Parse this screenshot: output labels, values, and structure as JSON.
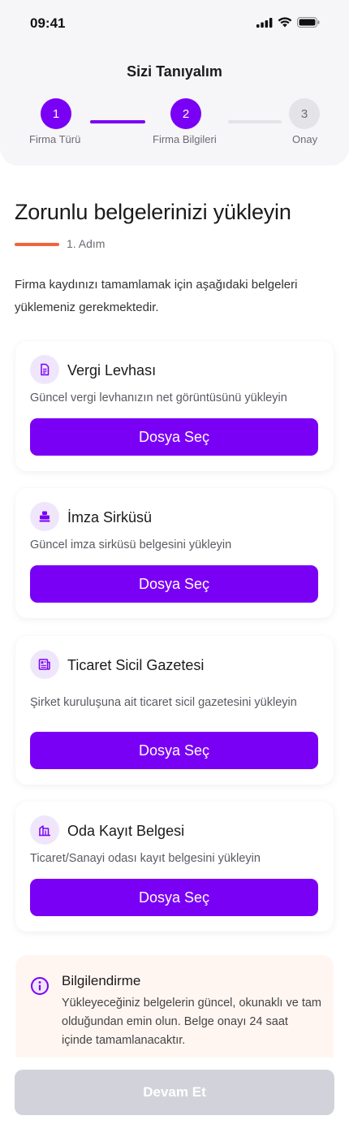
{
  "status_bar": {
    "time": "09:41"
  },
  "header": {
    "title": "Sizi Tanıyalım"
  },
  "stepper": {
    "steps": [
      {
        "number": "1",
        "label": "Firma Türü"
      },
      {
        "number": "2",
        "label": "Firma Bilgileri"
      },
      {
        "number": "3",
        "label": "Onay"
      }
    ],
    "current_step": 2,
    "active_color": "#7a00f5",
    "inactive_color": "#e3e3e8"
  },
  "main": {
    "heading": "Zorunlu belgelerinizi yükleyin",
    "step_indicator": "1. Adım",
    "description": "Firma kaydınızı tamamlamak için aşağıdaki belgeleri yüklemeniz gerekmektedir."
  },
  "documents": [
    {
      "icon": "document-icon",
      "title": "Vergi Levhası",
      "description": "Güncel vergi levhanızın net görüntüsünü yükleyin",
      "button_label": "Dosya Seç"
    },
    {
      "icon": "stamp-icon",
      "title": "İmza Sirküsü",
      "description": "Güncel imza sirküsü belgesini yükleyin",
      "button_label": "Dosya Seç"
    },
    {
      "icon": "newspaper-icon",
      "title": "Ticaret Sicil Gazetesi",
      "description": "Şirket kuruluşuna ait ticaret sicil gazetesini yükleyin",
      "button_label": "Dosya Seç"
    },
    {
      "icon": "building-icon",
      "title": "Oda Kayıt Belgesi",
      "description": "Ticaret/Sanayi odası kayıt belgesini yükleyin",
      "button_label": "Dosya Seç"
    }
  ],
  "info": {
    "icon": "info-icon",
    "title": "Bilgilendirme",
    "text": "Yükleyeceğiniz belgelerin güncel, okunaklı ve tam olduğundan emin olun. Belge onayı 24 saat içinde tamamlanacaktır."
  },
  "footer": {
    "continue_label": "Devam Et",
    "continue_enabled": false
  },
  "colors": {
    "accent": "#7a00f5",
    "orange": "#f0643c",
    "info_bg": "#fff6f2",
    "disabled_button": "#d2d3da"
  }
}
